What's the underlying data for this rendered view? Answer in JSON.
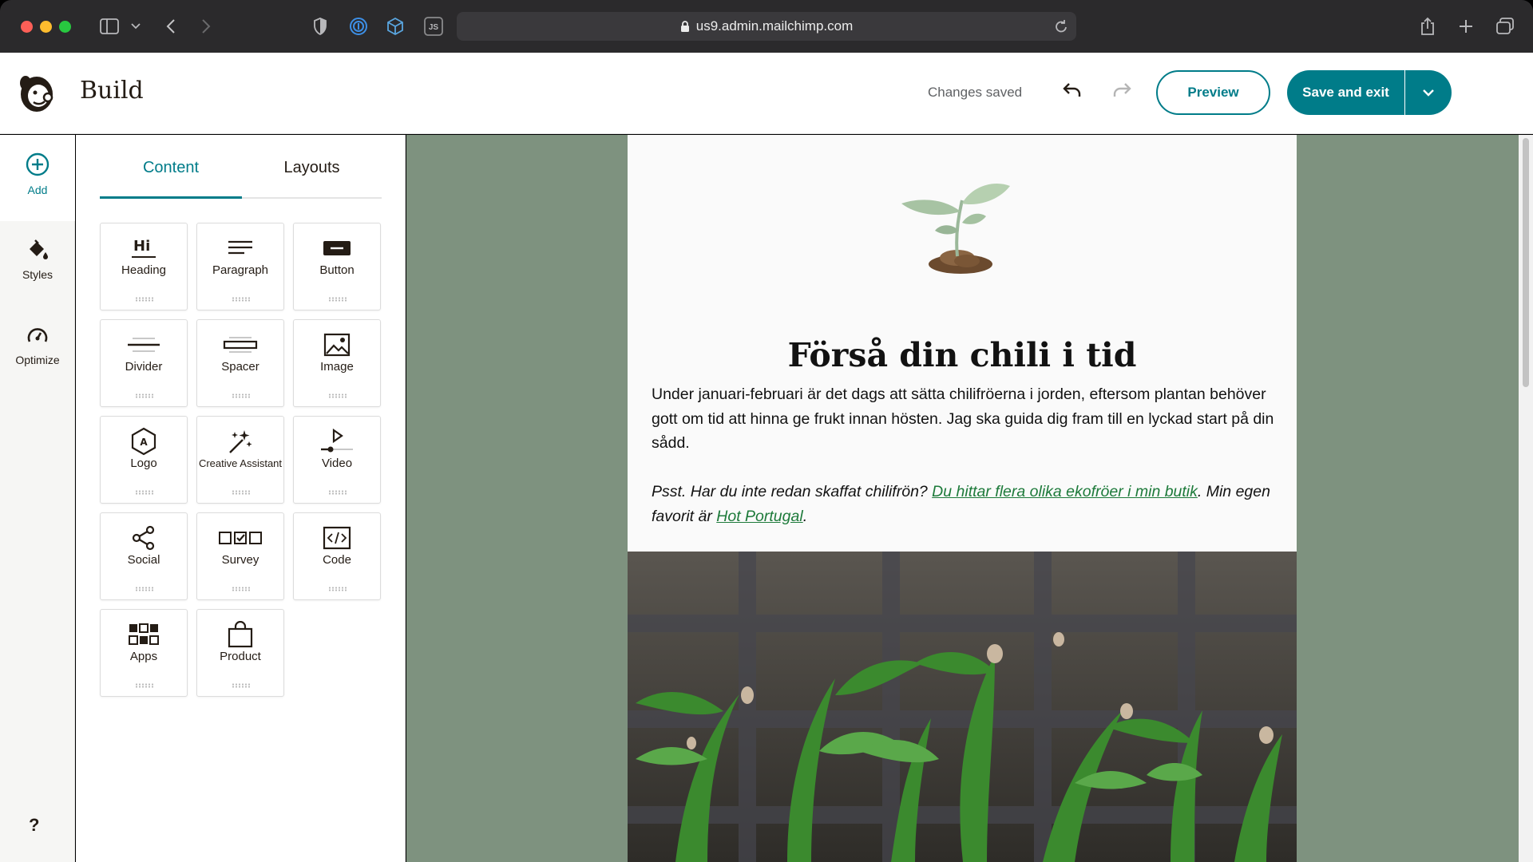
{
  "browser": {
    "url": "us9.admin.mailchimp.com"
  },
  "header": {
    "title": "Build",
    "status": "Changes saved",
    "preview_label": "Preview",
    "save_label": "Save and exit"
  },
  "rail": {
    "items": [
      {
        "label": "Add",
        "icon": "add-circle-icon"
      },
      {
        "label": "Styles",
        "icon": "paint-bucket-icon"
      },
      {
        "label": "Optimize",
        "icon": "gauge-icon"
      }
    ],
    "help": "?"
  },
  "panel": {
    "tabs": [
      {
        "label": "Content",
        "active": true
      },
      {
        "label": "Layouts",
        "active": false
      }
    ],
    "blocks": [
      {
        "label": "Heading",
        "icon": "heading-icon"
      },
      {
        "label": "Paragraph",
        "icon": "paragraph-icon"
      },
      {
        "label": "Button",
        "icon": "button-icon"
      },
      {
        "label": "Divider",
        "icon": "divider-icon"
      },
      {
        "label": "Spacer",
        "icon": "spacer-icon"
      },
      {
        "label": "Image",
        "icon": "image-icon"
      },
      {
        "label": "Logo",
        "icon": "logo-icon"
      },
      {
        "label": "Creative Assistant",
        "icon": "magic-wand-icon"
      },
      {
        "label": "Video",
        "icon": "video-icon"
      },
      {
        "label": "Social",
        "icon": "share-icon"
      },
      {
        "label": "Survey",
        "icon": "survey-icon"
      },
      {
        "label": "Code",
        "icon": "code-icon"
      },
      {
        "label": "Apps",
        "icon": "apps-icon"
      },
      {
        "label": "Product",
        "icon": "shopping-bag-icon"
      }
    ]
  },
  "email": {
    "title": "Förså din chili i tid",
    "body": "Under januari-februari är det dags att sätta chilifröerna i jorden, eftersom plantan behöver gott om tid att hinna ge frukt innan hösten. Jag ska guida dig fram till en lyckad start på din sådd.",
    "ps_prefix": "Psst. Har du inte redan skaffat chilifrön? ",
    "ps_link1": "Du hittar flera olika ekofröer i min butik",
    "ps_middle": ". Min egen favorit är ",
    "ps_link2": "Hot Portugal",
    "ps_suffix": "."
  },
  "colors": {
    "accent": "#007c89",
    "canvas_bg": "#7e927f",
    "link": "#1d7a3a"
  }
}
